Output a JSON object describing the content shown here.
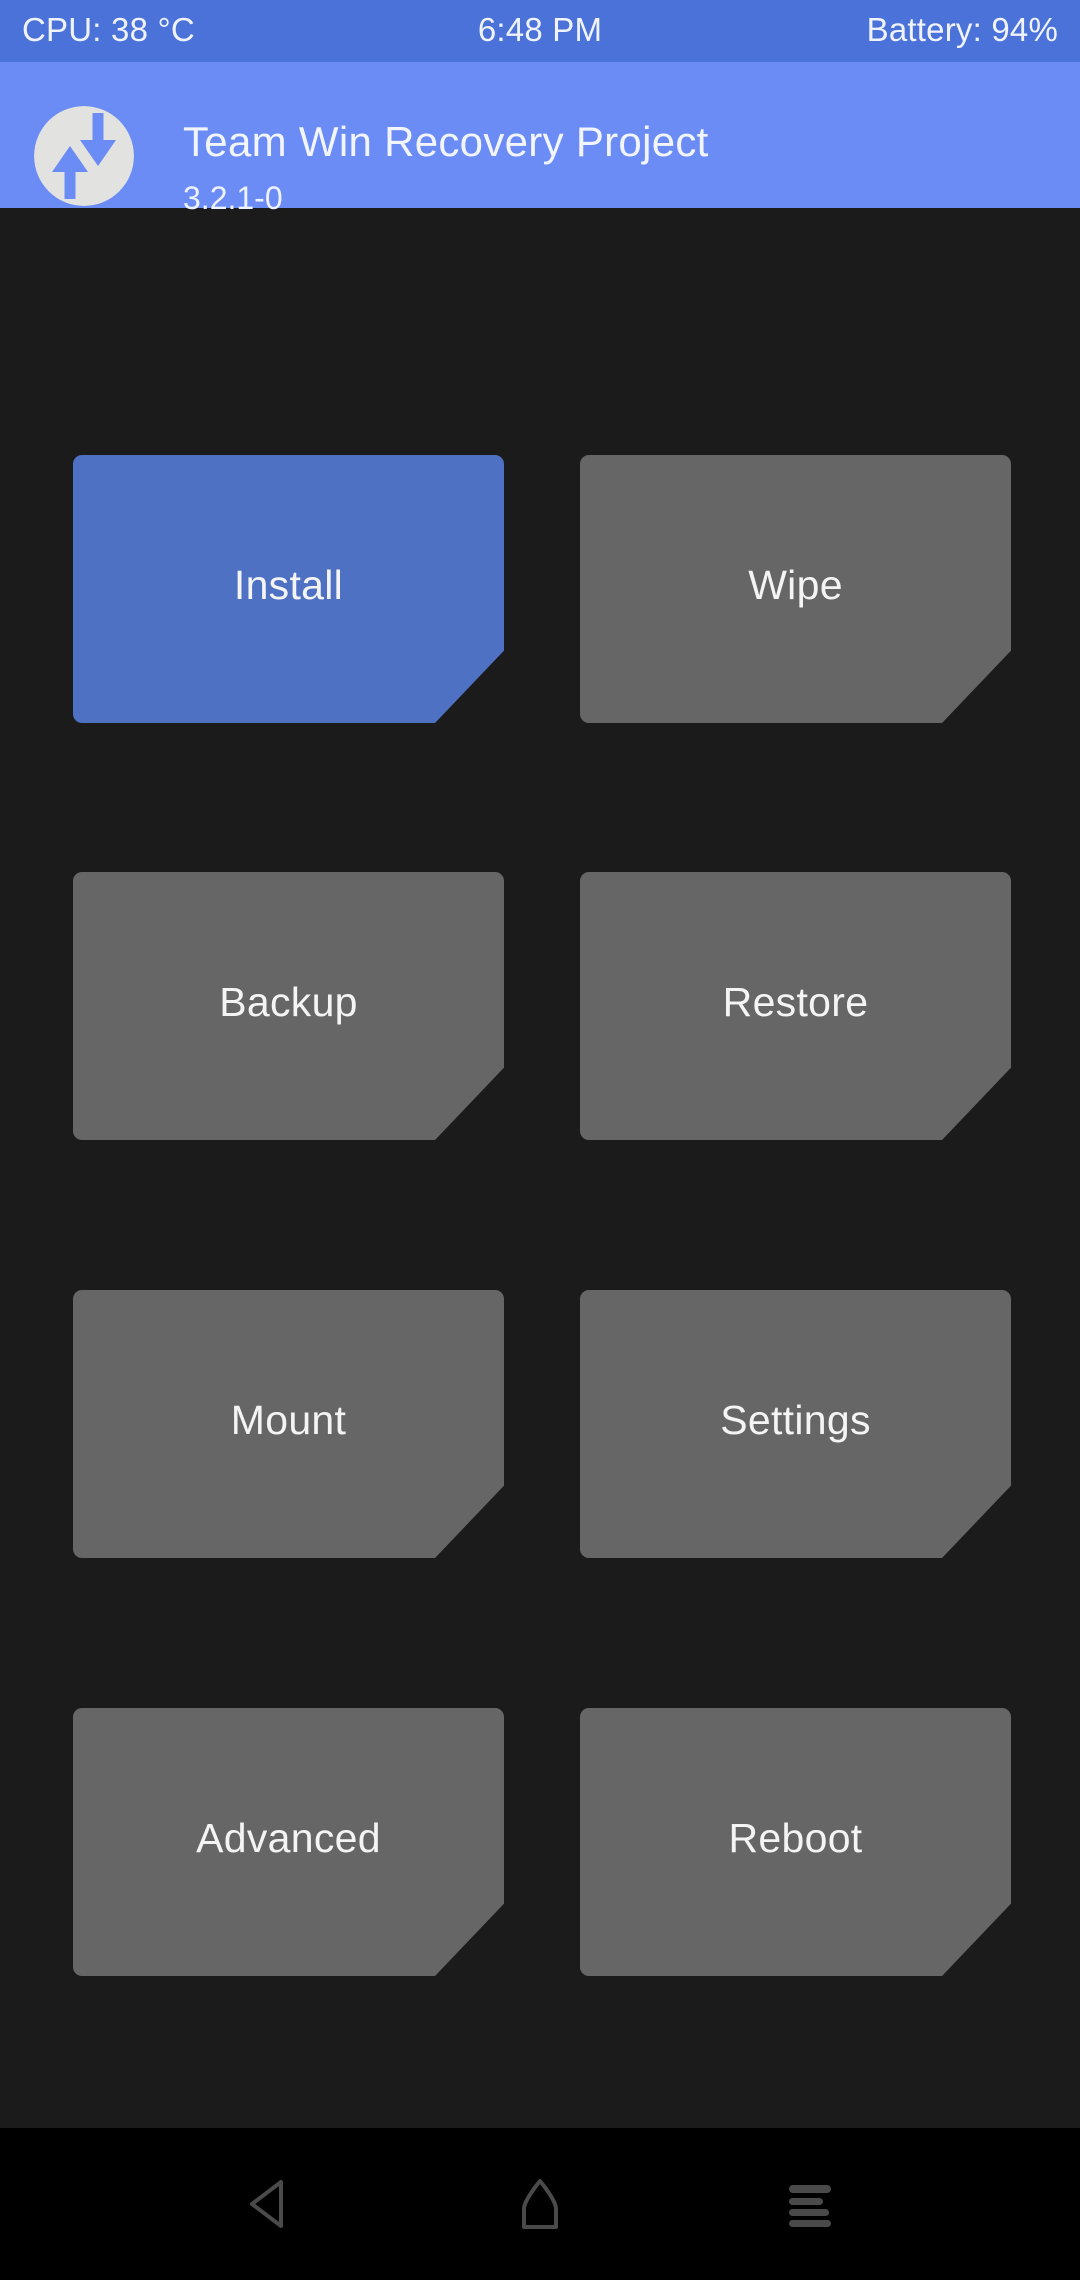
{
  "status_bar": {
    "cpu": "CPU: 38 °C",
    "clock": "6:48 PM",
    "battery": "Battery: 94%",
    "background_color": "#4a72d8",
    "text_color": "#f0f3fb"
  },
  "header": {
    "title": "Team Win Recovery Project",
    "version": "3.2.1-0",
    "logo_icon": "twrp-logo-icon",
    "background_color": "#6b8cf5",
    "text_color": "#f2f5fd"
  },
  "main": {
    "background_color": "#1b1b1b",
    "tile_color": "#666666",
    "tile_selected_color": "#4f71c4",
    "tile_label_color": "#f4f4f4",
    "tiles": [
      {
        "label": "Install",
        "selected": true
      },
      {
        "label": "Wipe",
        "selected": false
      },
      {
        "label": "Backup",
        "selected": false
      },
      {
        "label": "Restore",
        "selected": false
      },
      {
        "label": "Mount",
        "selected": false
      },
      {
        "label": "Settings",
        "selected": false
      },
      {
        "label": "Advanced",
        "selected": false
      },
      {
        "label": "Reboot",
        "selected": false
      }
    ]
  },
  "nav_bar": {
    "background_color": "#000000",
    "icon_color": "#4a4a4a",
    "buttons": [
      {
        "name": "back-icon",
        "label": "Back"
      },
      {
        "name": "home-icon",
        "label": "Home"
      },
      {
        "name": "recents-icon",
        "label": "Recents"
      }
    ]
  }
}
